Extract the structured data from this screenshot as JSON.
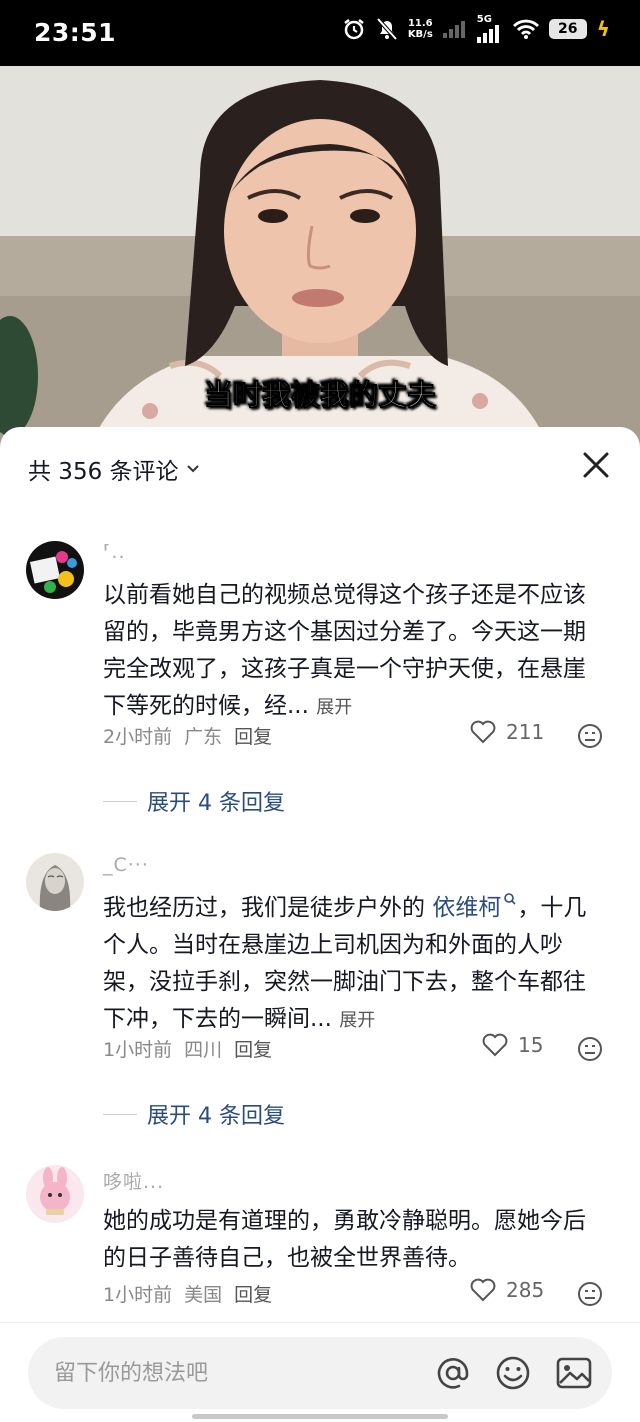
{
  "status_bar": {
    "time": "23:51",
    "net_speed_value": "11.6",
    "net_speed_unit": "KB/s",
    "network": "5G",
    "battery": "26"
  },
  "video": {
    "subtitle": "当时我被我的丈夫"
  },
  "comments_panel": {
    "title": "共 356 条评论",
    "comments": [
      {
        "username": "⸢..",
        "text": "以前看她自己的视频总觉得这个孩子还是不应该留的，毕竟男方这个基因过分差了。今天这一期完全改观了，这孩子真是一个守护天使，在悬崖下等死的时候，经...",
        "expand_label": "展开",
        "time": "2小时前",
        "location": "广东",
        "reply_label": "回复",
        "likes": "211",
        "replies_label": "展开 4 条回复"
      },
      {
        "username": "_C···",
        "text_before": "我也经历过，我们是徒步户外的",
        "mention": "依维柯",
        "text_after": "，十几个人。当时在悬崖边上司机因为和外面的人吵架，没拉手刹，突然一脚油门下去，整个车都往下冲，下去的一瞬间...",
        "expand_label": "展开",
        "time": "1小时前",
        "location": "四川",
        "reply_label": "回复",
        "likes": "15",
        "replies_label": "展开 4 条回复"
      },
      {
        "username": "哆啦...",
        "text": "她的成功是有道理的，勇敢冷静聪明。愿她今后的日子善待自己，也被全世界善待。",
        "time": "1小时前",
        "location": "美国",
        "reply_label": "回复",
        "likes": "285"
      }
    ]
  },
  "input_bar": {
    "placeholder": "留下你的想法吧"
  },
  "colors": {
    "link": "#2b4d7e",
    "sheet_bg": "#ffffff",
    "battery_bolt": "#f5c400"
  }
}
